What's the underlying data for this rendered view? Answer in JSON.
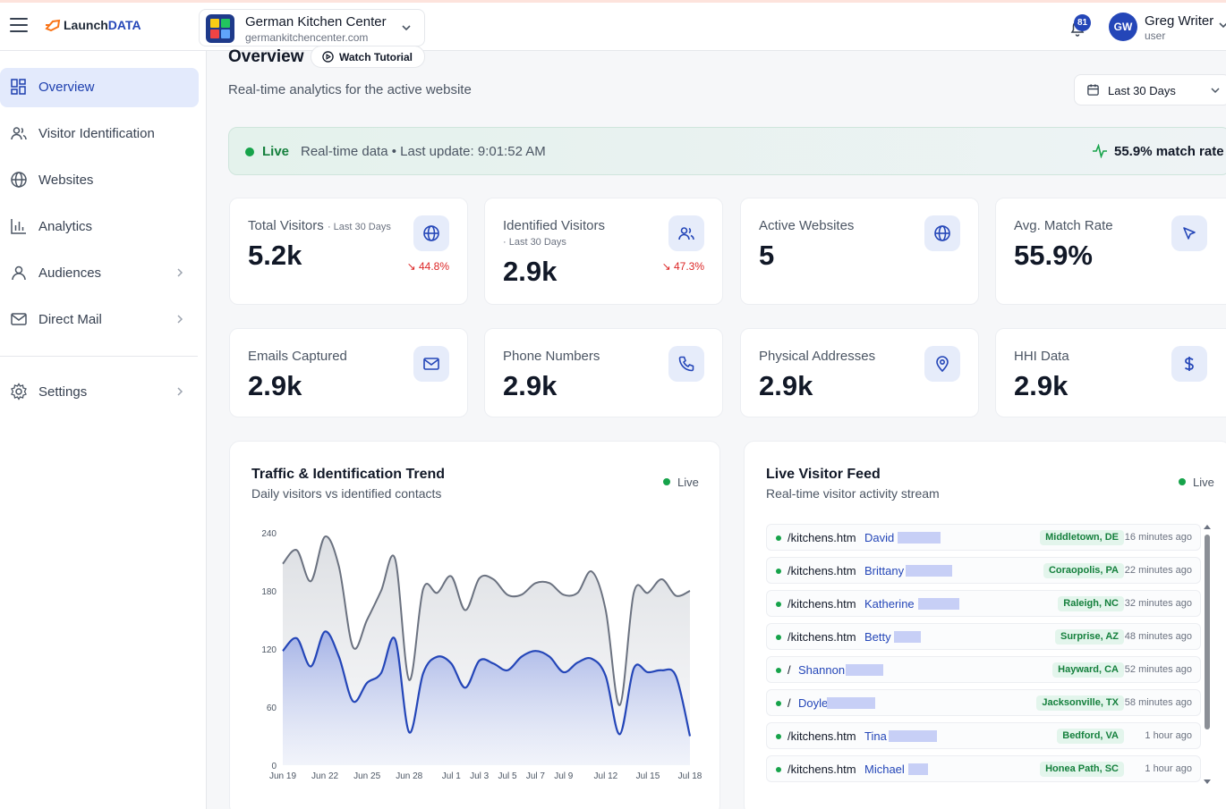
{
  "header": {
    "logo_prefix": "Launch",
    "logo_suffix": "DATA",
    "site_name": "German Kitchen Center",
    "site_domain": "germankitchencenter.com",
    "notification_count": "81",
    "user_initials": "GW",
    "user_name": "Greg Writer",
    "user_role": "user"
  },
  "sidebar": {
    "items": [
      {
        "label": "Overview",
        "icon": "grid-icon",
        "active": true
      },
      {
        "label": "Visitor Identification",
        "icon": "users-icon"
      },
      {
        "label": "Websites",
        "icon": "globe-icon"
      },
      {
        "label": "Analytics",
        "icon": "bar-chart-icon"
      },
      {
        "label": "Audiences",
        "icon": "user-icon",
        "has_submenu": true
      },
      {
        "label": "Direct Mail",
        "icon": "mail-icon",
        "has_submenu": true
      },
      {
        "label": "Settings",
        "icon": "gear-icon",
        "has_submenu": true
      }
    ]
  },
  "main": {
    "title": "Overview",
    "tutorial_label": "Watch Tutorial",
    "subtitle": "Real-time analytics for the active website",
    "date_range": "Last 30 Days"
  },
  "live_banner": {
    "status": "Live",
    "info": "Real-time data • Last update: 9:01:52 AM",
    "match_rate": "55.9% match rate"
  },
  "stats": [
    {
      "label": "Total Visitors",
      "sublabel": "· Last 30 Days",
      "value": "5.2k",
      "delta": "44.8%",
      "icon": "globe-icon"
    },
    {
      "label": "Identified Visitors",
      "sublabel": "· Last 30 Days",
      "value": "2.9k",
      "delta": "47.3%",
      "icon": "users-icon"
    },
    {
      "label": "Active Websites",
      "value": "5",
      "icon": "globe-icon"
    },
    {
      "label": "Avg. Match Rate",
      "value": "55.9%",
      "icon": "cursor-icon"
    },
    {
      "label": "Emails Captured",
      "value": "2.9k",
      "icon": "mail-icon"
    },
    {
      "label": "Phone Numbers",
      "value": "2.9k",
      "icon": "phone-icon"
    },
    {
      "label": "Physical Addresses",
      "value": "2.9k",
      "icon": "map-pin-icon"
    },
    {
      "label": "HHI Data",
      "value": "2.9k",
      "icon": "dollar-icon"
    }
  ],
  "trend": {
    "title": "Traffic & Identification Trend",
    "subtitle": "Daily visitors vs identified contacts",
    "live": "Live"
  },
  "feed": {
    "title": "Live Visitor Feed",
    "subtitle": "Real-time visitor activity stream",
    "live": "Live",
    "rows": [
      {
        "page": "/kitchens.htm",
        "name": "David",
        "location": "Middletown, DE",
        "time": "16 minutes ago"
      },
      {
        "page": "/kitchens.htm",
        "name": "Brittany",
        "location": "Coraopolis, PA",
        "time": "22 minutes ago"
      },
      {
        "page": "/kitchens.htm",
        "name": "Katherine",
        "location": "Raleigh, NC",
        "time": "32 minutes ago"
      },
      {
        "page": "/kitchens.htm",
        "name": "Betty",
        "location": "Surprise, AZ",
        "time": "48 minutes ago"
      },
      {
        "page": "/",
        "name": "Shannon",
        "location": "Hayward, CA",
        "time": "52 minutes ago"
      },
      {
        "page": "/",
        "name": "Doyle",
        "location": "Jacksonville, TX",
        "time": "58 minutes ago"
      },
      {
        "page": "/kitchens.htm",
        "name": "Tina",
        "location": "Bedford, VA",
        "time": "1 hour ago"
      },
      {
        "page": "/kitchens.htm",
        "name": "Michael",
        "location": "Honea Path, SC",
        "time": "1 hour ago"
      }
    ]
  },
  "colors": {
    "accent": "#2446b8",
    "live_green": "#16a34a",
    "visitors_line": "#6b7280",
    "identified_line": "#2446b8"
  },
  "chart_data": {
    "type": "area",
    "x": [
      "Jun 19",
      "Jun 20",
      "Jun 21",
      "Jun 22",
      "Jun 23",
      "Jun 24",
      "Jun 25",
      "Jun 26",
      "Jun 27",
      "Jun 28",
      "Jun 29",
      "Jun 30",
      "Jul 1",
      "Jul 2",
      "Jul 3",
      "Jul 4",
      "Jul 5",
      "Jul 6",
      "Jul 7",
      "Jul 8",
      "Jul 9",
      "Jul 10",
      "Jul 11",
      "Jul 12",
      "Jul 13",
      "Jul 14",
      "Jul 15",
      "Jul 16",
      "Jul 17",
      "Jul 18"
    ],
    "tick_labels": [
      "Jun 19",
      "Jun 22",
      "Jun 25",
      "Jun 28",
      "Jul 1",
      "Jul 3",
      "Jul 5",
      "Jul 7",
      "Jul 9",
      "Jul 12",
      "Jul 15",
      "Jul 18"
    ],
    "series": [
      {
        "values": [
          208,
          222,
          190,
          236,
          205,
          122,
          150,
          180,
          213,
          88,
          182,
          178,
          195,
          160,
          193,
          192,
          176,
          176,
          188,
          188,
          176,
          178,
          200,
          160,
          62,
          178,
          178,
          192,
          175,
          180
        ]
      },
      {
        "values": [
          118,
          131,
          102,
          138,
          112,
          66,
          85,
          95,
          130,
          34,
          95,
          112,
          105,
          80,
          108,
          105,
          98,
          112,
          118,
          112,
          96,
          106,
          110,
          92,
          32,
          100,
          96,
          98,
          92,
          30
        ]
      }
    ],
    "ylim": [
      0,
      240
    ],
    "yticks": [
      "0",
      "60",
      "120",
      "180",
      "240"
    ]
  }
}
